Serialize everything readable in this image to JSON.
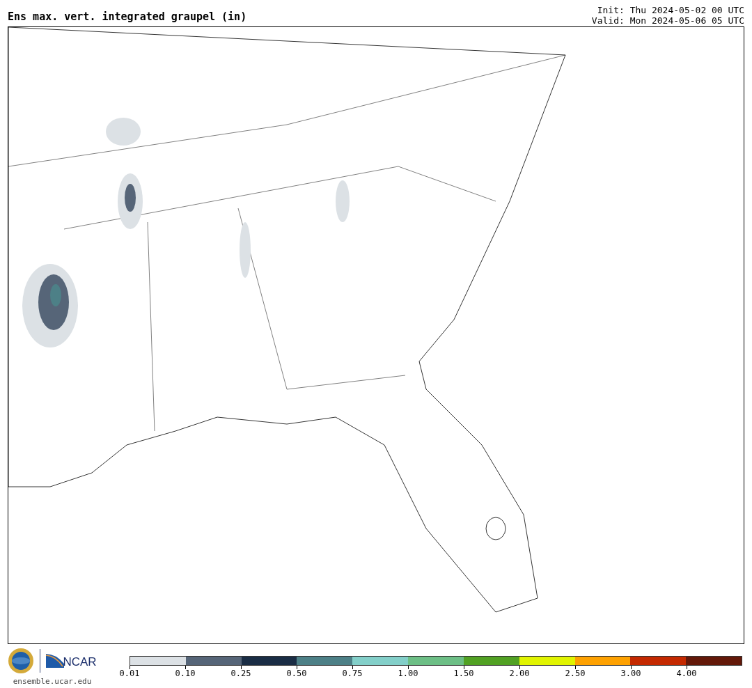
{
  "title": "Ens max. vert. integrated graupel (in)",
  "init": "Init: Thu 2024-05-02 00 UTC",
  "valid": "Valid: Mon 2024-05-06 05 UTC",
  "logos": {
    "org": "NCAR",
    "url": "ensemble.ucar.edu"
  },
  "colorbar": [
    {
      "label": "0.01",
      "color": "#dce1e5"
    },
    {
      "label": "0.10",
      "color": "#566578"
    },
    {
      "label": "0.25",
      "color": "#1a2d45"
    },
    {
      "label": "0.50",
      "color": "#4d8087"
    },
    {
      "label": "0.75",
      "color": "#83cfc9"
    },
    {
      "label": "1.00",
      "color": "#6dbf86"
    },
    {
      "label": "1.50",
      "color": "#51a123"
    },
    {
      "label": "2.00",
      "color": "#e1f400"
    },
    {
      "label": "2.50",
      "color": "#fea100"
    },
    {
      "label": "3.00",
      "color": "#c42900"
    },
    {
      "label": "4.00",
      "color": "#631809"
    }
  ]
}
